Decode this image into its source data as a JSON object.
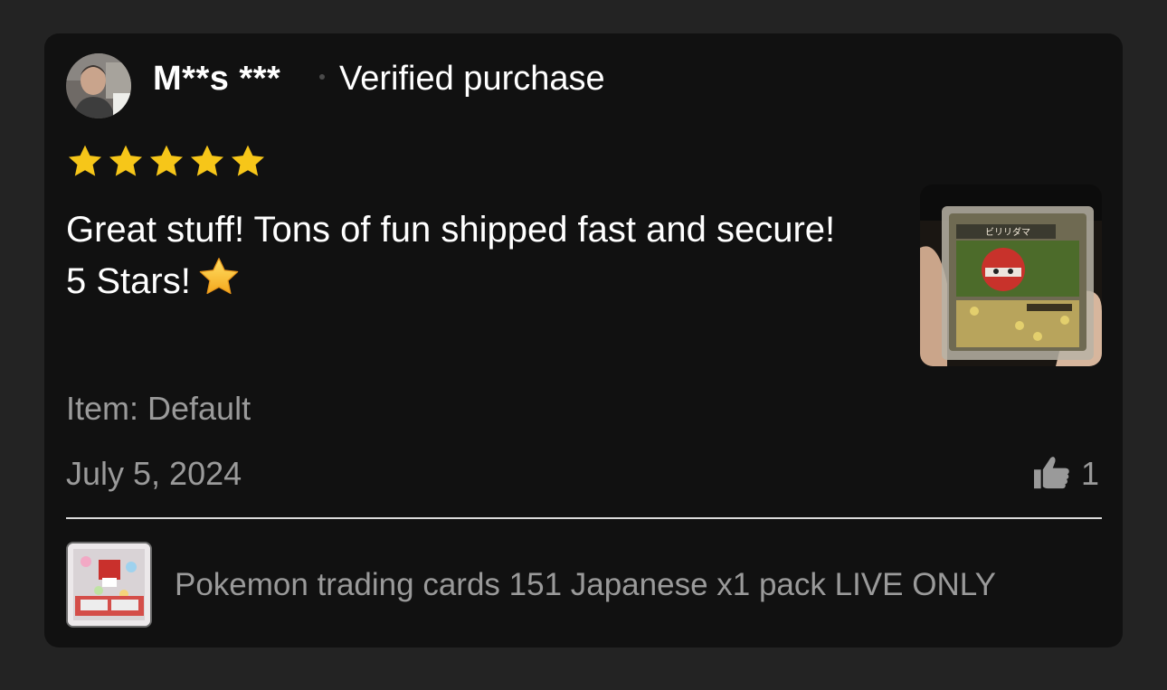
{
  "review": {
    "reviewer_name": "M**s ***",
    "verified_label": "Verified purchase",
    "rating": 5,
    "max_rating": 5,
    "text": "Great stuff! Tons of fun shipped fast and secure! 5 Stars!",
    "text_emoji": "star-emoji",
    "item_label": "Item: Default",
    "date": "July 5, 2024",
    "helpful_count": "1"
  },
  "product": {
    "title": "Pokemon trading cards 151 Japanese x1 pack LIVE ONLY"
  },
  "colors": {
    "background": "#232323",
    "card": "#111111",
    "star": "#f6c619",
    "primary_text": "#ffffff",
    "secondary_text": "#9a9a9a",
    "divider": "#dcdcdc"
  },
  "icons": {
    "star": "star-icon",
    "like": "thumbs-up-icon"
  }
}
